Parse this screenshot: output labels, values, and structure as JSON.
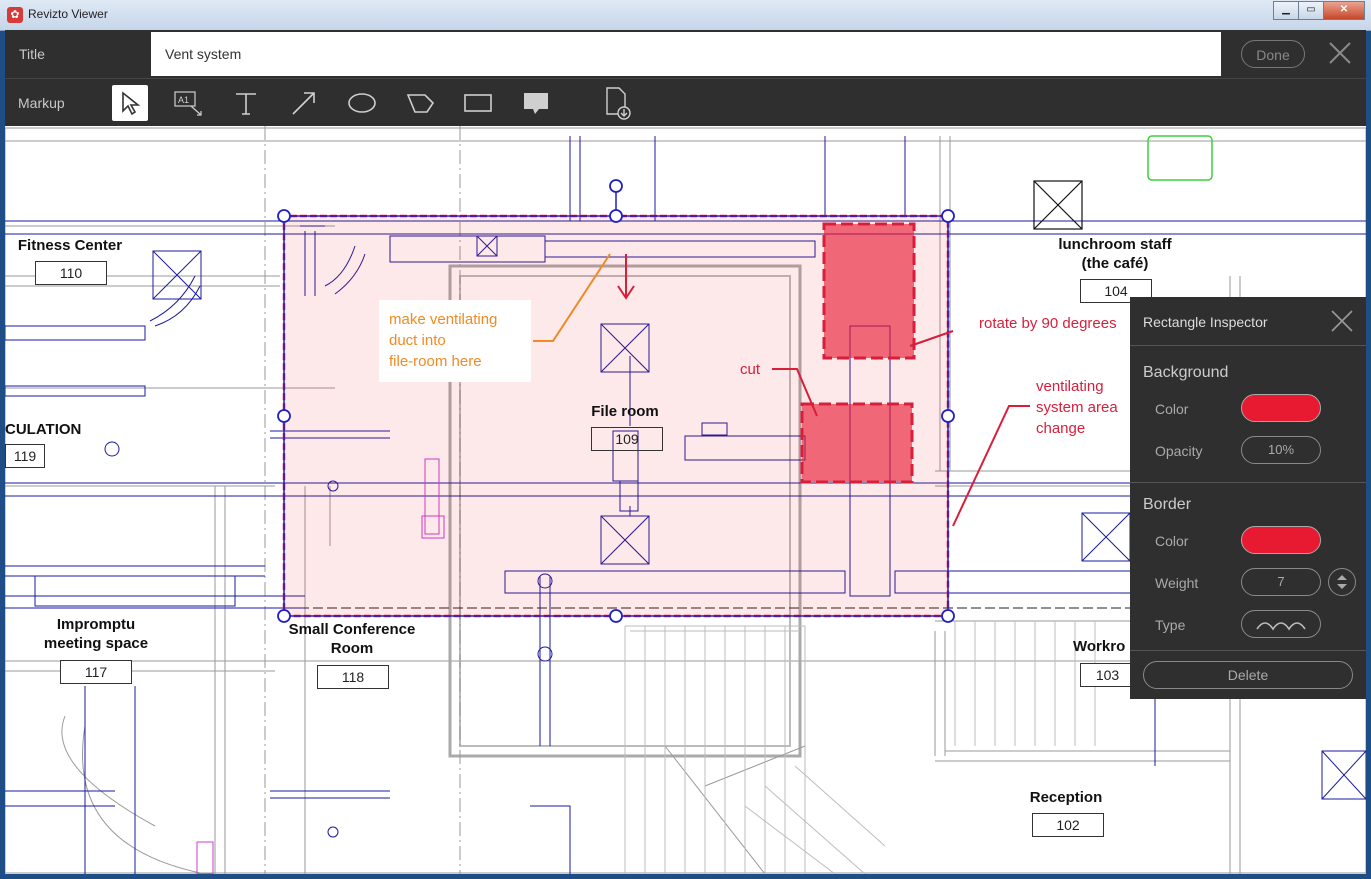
{
  "window": {
    "title": "Revizto Viewer",
    "controls": [
      "minimize",
      "maximize",
      "close"
    ]
  },
  "title_bar": {
    "label": "Title",
    "value": "Vent system",
    "done_label": "Done"
  },
  "markup_bar": {
    "label": "Markup",
    "tools": [
      {
        "name": "select-tool",
        "icon": "arrow-cursor-icon",
        "active": true
      },
      {
        "name": "callout-tool",
        "icon": "a1-callout-icon",
        "active": false
      },
      {
        "name": "text-tool",
        "icon": "text-t-icon",
        "active": false
      },
      {
        "name": "arrow-tool",
        "icon": "diagonal-arrow-icon",
        "active": false
      },
      {
        "name": "ellipse-tool",
        "icon": "ellipse-icon",
        "active": false
      },
      {
        "name": "cloud-tool",
        "icon": "cloud-shape-icon",
        "active": false
      },
      {
        "name": "rectangle-tool",
        "icon": "rectangle-icon",
        "active": false
      },
      {
        "name": "comment-tool",
        "icon": "speech-bubble-icon",
        "active": false
      },
      {
        "name": "export-tool",
        "icon": "document-download-icon",
        "active": false
      }
    ]
  },
  "drawing": {
    "rooms": [
      {
        "name": "Fitness Center",
        "number": "110"
      },
      {
        "name": "lunchroom staff\n(the café)",
        "number": "104"
      },
      {
        "name": "CULATION",
        "number": "119"
      },
      {
        "name": "File room",
        "number": "109"
      },
      {
        "name": "Impromptu\nmeeting space",
        "number": "117"
      },
      {
        "name": "Small Conference\nRoom",
        "number": "118"
      },
      {
        "name": "Workro",
        "number": "103"
      },
      {
        "name": "Reception",
        "number": "102"
      }
    ],
    "annotations": [
      {
        "text": "make ventilating\nduct into\nfile-room here",
        "color": "#f08a24"
      },
      {
        "text": "cut",
        "color": "#d81e3a"
      },
      {
        "text": "rotate by 90 degrees",
        "color": "#d81e3a"
      },
      {
        "text": "ventilating\nsystem area\nchange",
        "color": "#d81e3a"
      }
    ],
    "colors": {
      "markup_red": "#e81a32",
      "plan_blue": "#1a1aa0",
      "orange_note": "#f08a24"
    }
  },
  "inspector": {
    "title": "Rectangle Inspector",
    "background": {
      "section": "Background",
      "color_label": "Color",
      "color": "#e81a32",
      "opacity_label": "Opacity",
      "opacity": "10%"
    },
    "border": {
      "section": "Border",
      "color_label": "Color",
      "color": "#e81a32",
      "weight_label": "Weight",
      "weight": "7",
      "type_label": "Type",
      "type_icon": "cloud-line-icon"
    },
    "delete_label": "Delete"
  }
}
